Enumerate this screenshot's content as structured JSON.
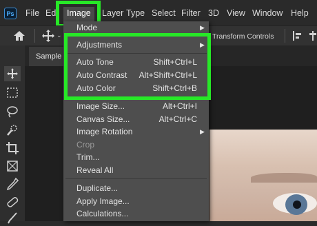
{
  "app": {
    "logo": "Ps"
  },
  "menubar": {
    "items": [
      "File",
      "Edi",
      "Image",
      "Layer",
      "Type",
      "Select",
      "Filter",
      "3D",
      "View",
      "Window",
      "Help"
    ]
  },
  "options_bar": {
    "transform_controls": "Transform Controls"
  },
  "tabs": {
    "document": "Sample"
  },
  "image_menu": {
    "mode": "Mode",
    "adjustments": "Adjustments",
    "auto_tone": {
      "label": "Auto Tone",
      "shortcut": "Shift+Ctrl+L"
    },
    "auto_contrast": {
      "label": "Auto Contrast",
      "shortcut": "Alt+Shift+Ctrl+L"
    },
    "auto_color": {
      "label": "Auto Color",
      "shortcut": "Shift+Ctrl+B"
    },
    "image_size": {
      "label": "Image Size...",
      "shortcut": "Alt+Ctrl+I"
    },
    "canvas_size": {
      "label": "Canvas Size...",
      "shortcut": "Alt+Ctrl+C"
    },
    "image_rotation": "Image Rotation",
    "crop": "Crop",
    "trim": "Trim...",
    "reveal_all": "Reveal All",
    "duplicate": "Duplicate...",
    "apply_image": "Apply Image...",
    "calculations": "Calculations..."
  },
  "colors": {
    "highlight": "#27e827",
    "menu_bg": "#4e4e4e",
    "app_bg": "#2b2b2b"
  }
}
